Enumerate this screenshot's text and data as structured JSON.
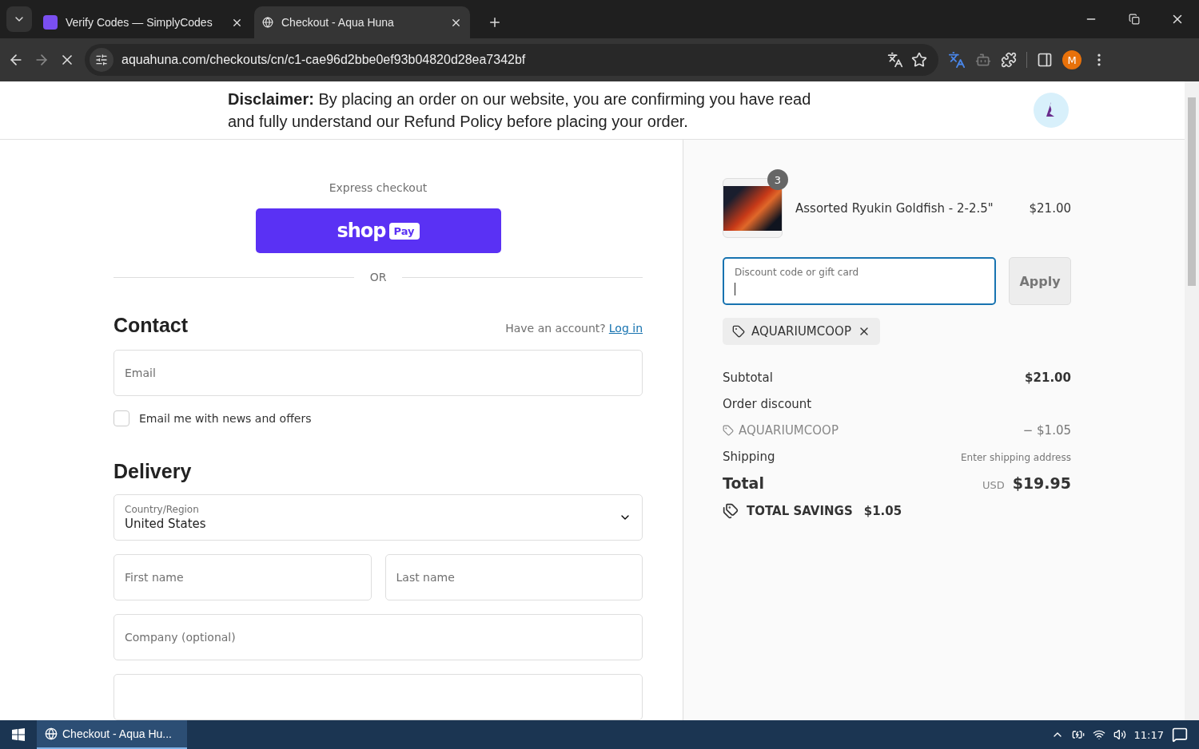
{
  "browser": {
    "tabs": [
      {
        "label": "Verify Codes — SimplyCodes",
        "selected": false
      },
      {
        "label": "Checkout - Aqua Huna",
        "selected": true
      }
    ],
    "url": "aquahuna.com/checkouts/cn/c1-cae96d2bbe0ef93b04820d28ea7342bf",
    "profile": "M"
  },
  "header": {
    "disclaimer": "**Disclaimer:** By placing an order on our website, you are confirming you have read and fully understand our Refund Policy before placing your order."
  },
  "express": {
    "title": "Express checkout",
    "shop_word": "shop",
    "pay_word": "Pay",
    "divider": "OR"
  },
  "contact": {
    "heading": "Contact",
    "account_prompt": "Have an account?",
    "login_link": "Log in",
    "email_placeholder": "Email",
    "newsletter": {
      "label": "Email me with news and offers",
      "checked": false
    }
  },
  "delivery": {
    "heading": "Delivery",
    "country": {
      "label": "Country/Region",
      "value": "United States"
    },
    "fields": [
      {
        "placeholder": "First name",
        "half": true
      },
      {
        "placeholder": "Last name",
        "half": true
      },
      {
        "placeholder": "Company (optional)",
        "half": false
      }
    ]
  },
  "summary": {
    "item": {
      "quantity": "3",
      "name": "Assorted Ryukin Goldfish - 2-2.5\"",
      "price": "$21.00"
    },
    "discount": {
      "placeholder": "Discount code or gift card",
      "focused": true,
      "apply": "Apply"
    },
    "applied_code": "AQUARIUMCOOP",
    "rows": [
      {
        "kind": "line",
        "label": "Subtotal",
        "value": "$21.00"
      },
      {
        "kind": "heading",
        "label": "Order discount"
      },
      {
        "kind": "code",
        "label": "AQUARIUMCOOP",
        "value": "− $1.05"
      },
      {
        "kind": "note",
        "label": "Shipping",
        "value": "Enter shipping address"
      },
      {
        "kind": "total",
        "label": "Total",
        "currency": "USD",
        "value": "$19.95"
      }
    ],
    "savings": {
      "label": "TOTAL SAVINGS",
      "value": "$1.05"
    }
  },
  "taskbar": {
    "app": "Checkout - Aqua Hu...",
    "time": "11:17"
  }
}
